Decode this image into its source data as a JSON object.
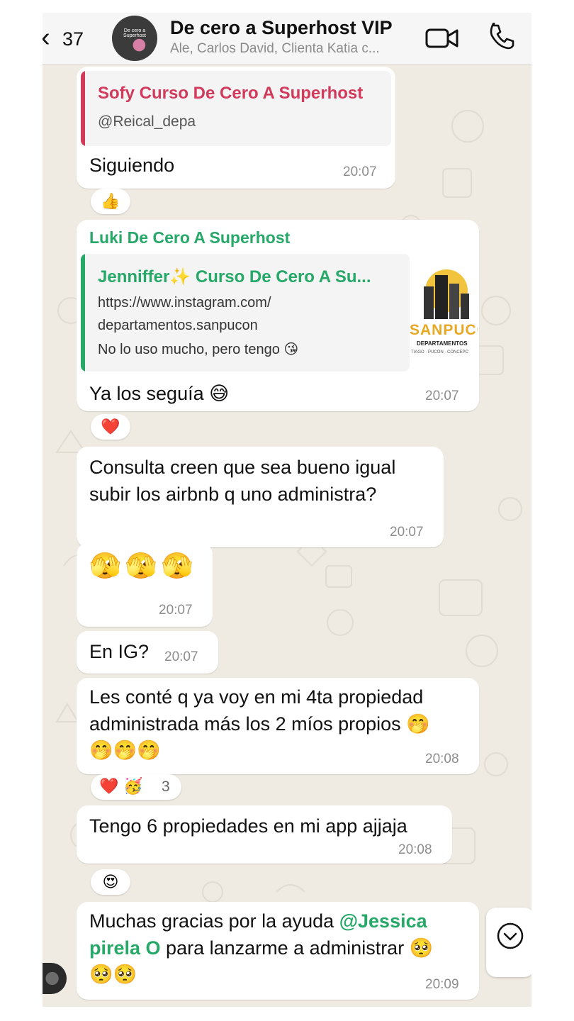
{
  "header": {
    "back_count": "37",
    "avatar_text": "De cero a Superhost",
    "title": "De cero a Superhost VIP",
    "subtitle": "Ale, Carlos David, Clienta Katia c..."
  },
  "colors": {
    "chat_bg": "#efeae2",
    "sender_green": "#25a868",
    "quote_red": "#d23a5c"
  },
  "messages": [
    {
      "quote_author": "Sofy Curso De Cero A Superhost",
      "quote_text": "@Reical_depa",
      "text": "Siguiendo",
      "time": "20:07",
      "reaction": "👍"
    },
    {
      "sender": "Luki De Cero A Superhost",
      "quote_author": "Jenniffer✨ Curso De Cero A Su...",
      "quote_line1": "https://www.instagram.com/",
      "quote_line2": "departamentos.sanpucon",
      "quote_line3": "No lo uso mucho, pero tengo 😘",
      "thumb_brand": "SANPUCO",
      "thumb_sub": "DEPARTAMENTOS",
      "thumb_cities": "TIAGO · PUCÓN · CONCEPC",
      "text": "Ya los seguía 😅",
      "time": "20:07",
      "reaction": "❤️"
    },
    {
      "line1": "Consulta creen que sea bueno igual",
      "line2": "subir los airbnb q uno administra?",
      "time": "20:07"
    },
    {
      "text": "🫣🫣🫣",
      "time": "20:07"
    },
    {
      "text": "En IG?",
      "time": "20:07"
    },
    {
      "line1": "Les conté q ya voy en mi 4ta propiedad",
      "line2": "administrada más los 2 míos propios 🤭",
      "line3": "🤭🤭🤭",
      "time": "20:08",
      "reaction": "❤️ 🥳",
      "reaction_count": "3"
    },
    {
      "text": "Tengo 6 propiedades en mi app ajjaja",
      "time": "20:08",
      "reaction": "😍"
    },
    {
      "line1_pre": "Muchas gracias por la ayuda ",
      "mention1": "@Jessica",
      "mention2": "pirela O",
      "line2_post": " para lanzarme a administrar 🥺",
      "line3": "🥺🥺",
      "time": "20:09"
    }
  ],
  "icons": {
    "back": "chevron-left-icon",
    "video": "video-camera-icon",
    "call": "phone-icon",
    "scroll": "chevron-down-circle-icon"
  }
}
